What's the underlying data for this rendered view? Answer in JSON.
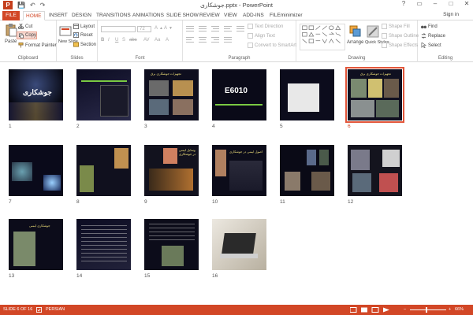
{
  "window": {
    "title": "جوشکاری.pptx - PowerPoint",
    "controls": [
      "?",
      "▭",
      "–",
      "□",
      "✕"
    ]
  },
  "qat": {
    "app_logo": "P",
    "save": "💾",
    "undo": "↶",
    "redo": "↷"
  },
  "tabs": [
    "FILE",
    "HOME",
    "INSERT",
    "DESIGN",
    "TRANSITIONS",
    "ANIMATIONS",
    "SLIDE SHOW",
    "REVIEW",
    "VIEW",
    "ADD-INS",
    "FILEminimizer"
  ],
  "active_tab": "HOME",
  "sign_in": "Sign in",
  "ribbon": {
    "clipboard": {
      "label": "Clipboard",
      "paste": "Paste",
      "cut": "Cut",
      "copy": "Copy",
      "format_painter": "Format Painter"
    },
    "slides": {
      "label": "Slides",
      "new_slide": "New Slide",
      "layout": "Layout",
      "reset": "Reset",
      "section": "Section"
    },
    "font": {
      "label": "Font",
      "size": "72",
      "bold": "B",
      "italic": "I",
      "underline": "U",
      "strike": "S",
      "shadow": "abc"
    },
    "paragraph": {
      "label": "Paragraph",
      "text_direction": "Text Direction",
      "align_text": "Align Text",
      "convert_smartart": "Convert to SmartArt"
    },
    "drawing": {
      "label": "Drawing",
      "arrange": "Arrange",
      "quick_styles": "Quick Styles",
      "shape_fill": "Shape Fill",
      "shape_outline": "Shape Outline",
      "shape_effects": "Shape Effects"
    },
    "editing": {
      "label": "Editing",
      "find": "Find",
      "replace": "Replace",
      "select": "Select"
    }
  },
  "slides": [
    {
      "num": "1",
      "title": "جوشکاری"
    },
    {
      "num": "2",
      "title": ""
    },
    {
      "num": "3",
      "title": "تجهیزات جوشکاری برق"
    },
    {
      "num": "4",
      "title": "E6010"
    },
    {
      "num": "5",
      "title": ""
    },
    {
      "num": "6",
      "title": "تجهیزات جوشکاری برق"
    },
    {
      "num": "7",
      "title": ""
    },
    {
      "num": "8",
      "title": ""
    },
    {
      "num": "9",
      "title": "وسایل ایمنی در جوشکاری"
    },
    {
      "num": "10",
      "title": "اصول ایمنی در جوشکاری"
    },
    {
      "num": "11",
      "title": ""
    },
    {
      "num": "12",
      "title": ""
    },
    {
      "num": "13",
      "title": "جوشکاری ایمنی"
    },
    {
      "num": "14",
      "title": ""
    },
    {
      "num": "15",
      "title": ""
    },
    {
      "num": "16",
      "title": ""
    }
  ],
  "selected_slide": "6",
  "status": {
    "slide_info": "SLIDE 6 OF 16",
    "language": "PERSIAN",
    "zoom": "66%"
  },
  "colors": {
    "accent": "#d24726",
    "selection": "#e2563a"
  }
}
